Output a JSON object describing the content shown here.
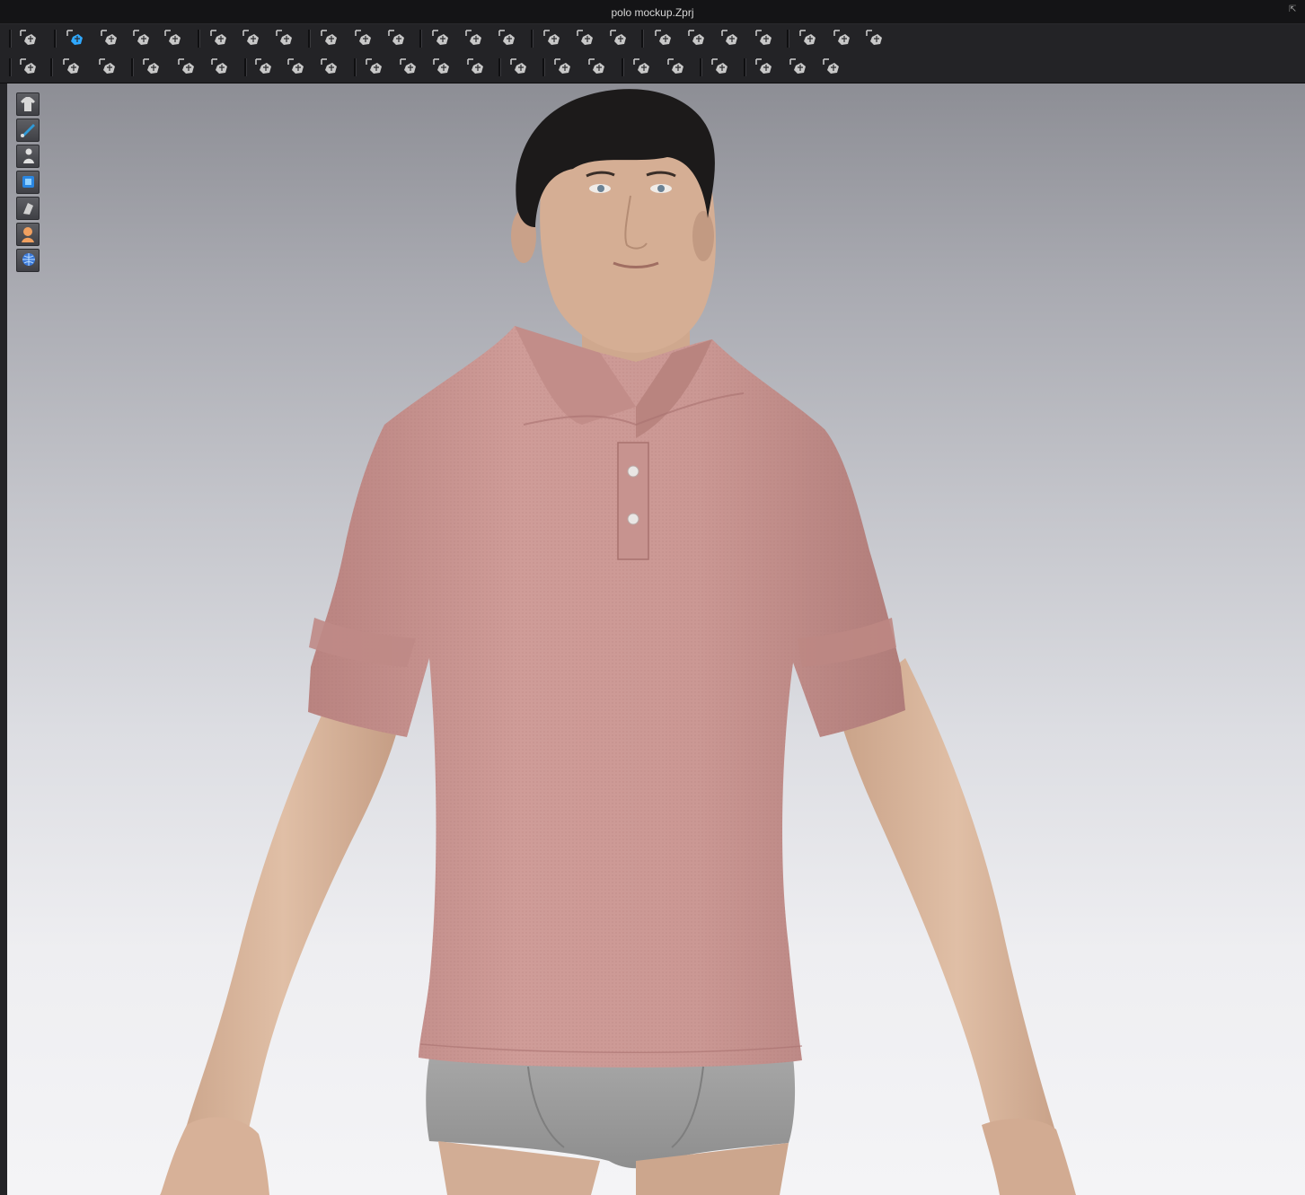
{
  "window": {
    "title": "polo mockup.Zprj"
  },
  "toolbar_row1": [
    "simulate-icon",
    "transform-pattern-icon",
    "select-box-icon",
    "transform-box-icon",
    "edit-pattern-icon",
    "edit-point-icon",
    "add-point-icon",
    "curve-point-icon",
    "cut-line-icon",
    "fold-icon",
    "pattern-icon",
    "arrange-icon",
    "symmetry-icon",
    "avatar-icon",
    "tack-up-icon",
    "tack-down-icon",
    "push-down-icon",
    "layer-up-icon",
    "layer-icon",
    "pin-icon",
    "pin-box-icon",
    "measure-icon",
    "tape-icon",
    "ruler-icon"
  ],
  "toolbar_row2": [
    "walk-icon",
    "brush-icon",
    "fold-arrange-icon",
    "seam-icon",
    "curve-seam-icon",
    "copy-icon",
    "texture-icon",
    "fill-icon",
    "shirt-texture-icon",
    "button-icon",
    "buttonhole-icon",
    "line-icon",
    "lock-icon",
    "zipper-icon",
    "puckering-icon",
    "graphic-icon",
    "trim-icon",
    "gradient-icon",
    "shrink-icon",
    "topstitch-icon",
    "garment-icon",
    "style-icon"
  ],
  "side_tools": [
    "show-garment-icon",
    "show-pattern-icon",
    "show-avatar-icon",
    "show-fabric-icon",
    "show-trim-icon",
    "show-skin-icon",
    "show-environment-icon"
  ],
  "colors": {
    "shirt": "#c4908c",
    "briefs": "#9a9a9a",
    "skin": "#d8b49a",
    "hair": "#1c1a1a"
  }
}
